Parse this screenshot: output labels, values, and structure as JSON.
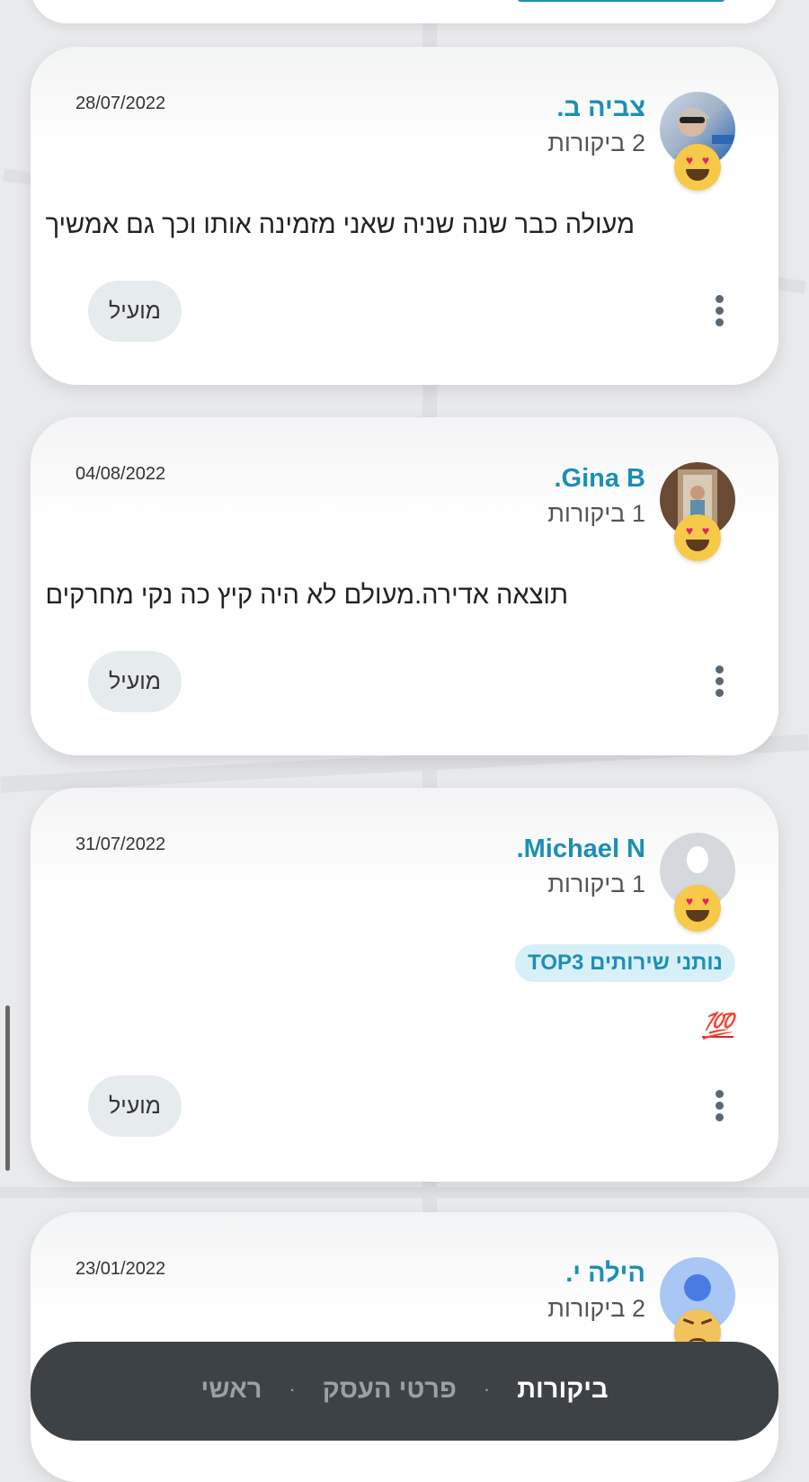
{
  "reviews": [
    {
      "name": "צביה ב.",
      "count": "2 ביקורות",
      "date": "28/07/2022",
      "text": "מעולה כבר שנה שניה שאני מזמינה אותו וכך גם אמשיך",
      "helpful_label": "מועיל",
      "reaction_icon": "heart-eyes-emoji-icon"
    },
    {
      "name": "Gina B.",
      "count": "1 ביקורות",
      "date": "04/08/2022",
      "text": "תוצאה אדירה.מעולם לא היה קיץ כה נקי מחרקים",
      "helpful_label": "מועיל",
      "reaction_icon": "heart-eyes-emoji-icon"
    },
    {
      "name": "Michael N.",
      "count": "1 ביקורות",
      "date": "31/07/2022",
      "badge": "נותני שירותים TOP3",
      "text": "💯",
      "helpful_label": "מועיל",
      "reaction_icon": "heart-eyes-emoji-icon"
    },
    {
      "name": "הילה י.",
      "count": "2 ביקורות",
      "date": "23/01/2022",
      "reaction_icon": "angry-emoji-icon"
    }
  ],
  "bottom_nav": {
    "home": "ראשי",
    "business_details": "פרטי העסק",
    "reviews": "ביקורות",
    "separator": "·",
    "active": "reviews"
  },
  "colors": {
    "accent": "#1b8fb5",
    "nav_bg": "#3d4246",
    "badge_bg": "#d7f0f7"
  }
}
